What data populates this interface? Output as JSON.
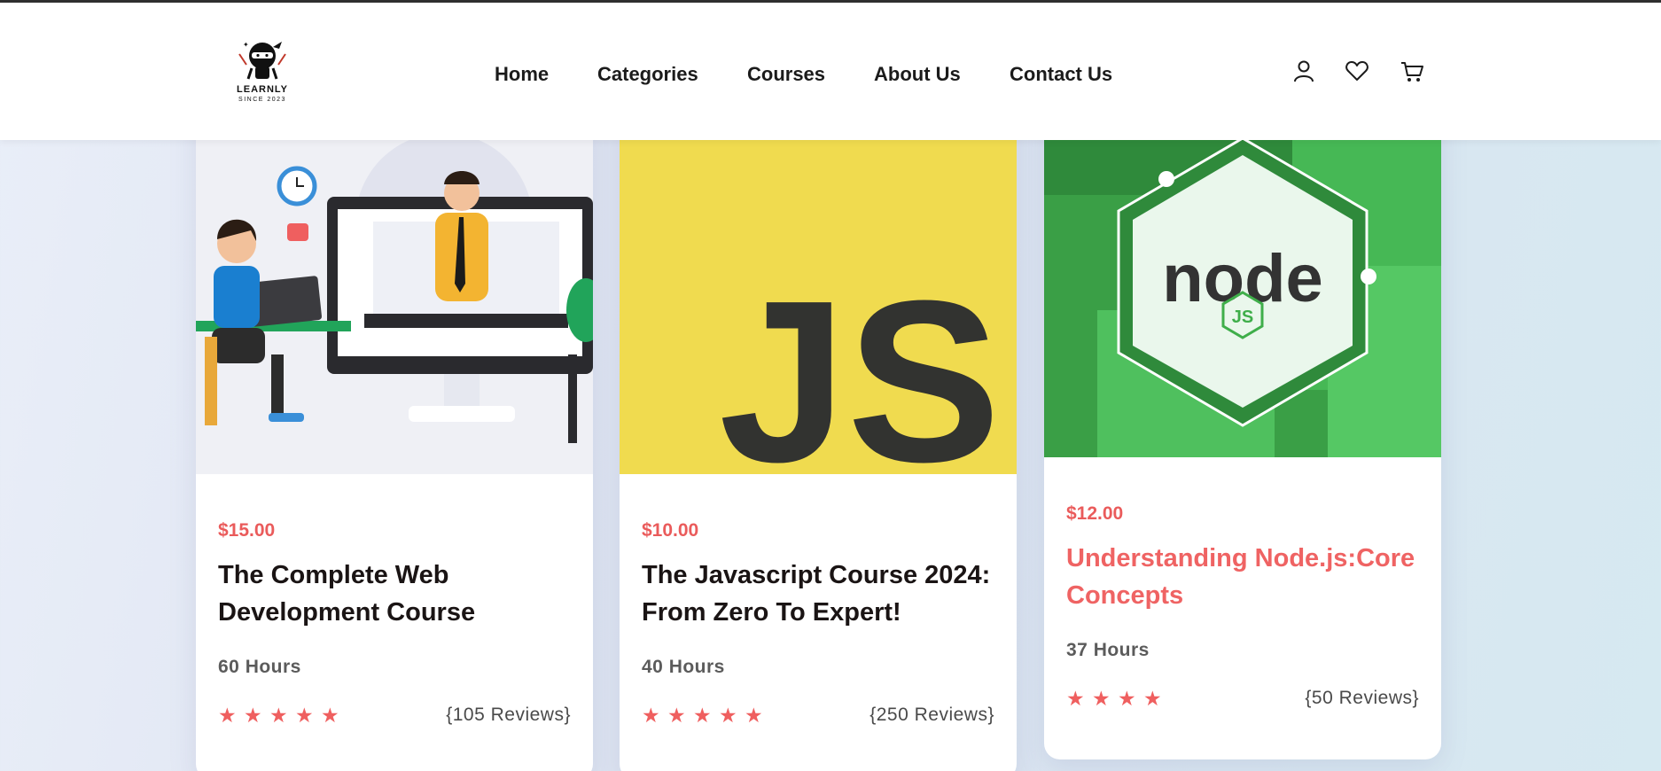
{
  "brand": {
    "name": "LEARNLY",
    "tagline": "SINCE 2023"
  },
  "nav": {
    "items": [
      "Home",
      "Categories",
      "Courses",
      "About Us",
      "Contact Us"
    ]
  },
  "header_icons": [
    "user-icon",
    "heart-icon",
    "cart-icon"
  ],
  "colors": {
    "accent": "#ef6363",
    "js_yellow": "#f0db4f",
    "node_green": "#3fae4a"
  },
  "courses": [
    {
      "price": "$15.00",
      "title": "The Complete Web Development Course",
      "hours": "60 Hours",
      "rating": 5,
      "reviews": "{105 Reviews}",
      "image": "web-development-illustration"
    },
    {
      "price": "$10.00",
      "title": "The Javascript Course 2024: From Zero To Expert!",
      "hours": "40 Hours",
      "rating": 5,
      "reviews": "{250 Reviews}",
      "image": "javascript-logo",
      "image_text": "JS"
    },
    {
      "price": "$12.00",
      "title": "Understanding Node.js:Core Concepts",
      "hours": "37 Hours",
      "rating": 4,
      "reviews": "{50 Reviews}",
      "image": "nodejs-logo",
      "image_text": "node",
      "image_badge": "JS"
    }
  ]
}
